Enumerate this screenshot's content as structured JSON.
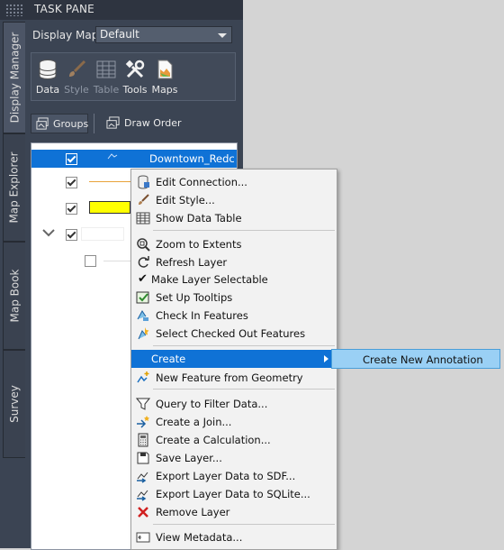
{
  "pane": {
    "title": "TASK PANE",
    "vertical_tabs": [
      "Display Manager",
      "Map Explorer",
      "Map Book",
      "Survey"
    ],
    "display_map_label": "Display Map:",
    "display_map_value": "Default",
    "toolbar": [
      {
        "label": "Data",
        "icon": "database-icon",
        "enabled": true
      },
      {
        "label": "Style",
        "icon": "brush-icon",
        "enabled": false
      },
      {
        "label": "Table",
        "icon": "table-icon",
        "enabled": false
      },
      {
        "label": "Tools",
        "icon": "tools-icon",
        "enabled": true
      },
      {
        "label": "Maps",
        "icon": "maps-icon",
        "enabled": true
      }
    ],
    "groups_label": "Groups",
    "draw_order_label": "Draw Order",
    "layer_name": "Downtown_Redc",
    "colors": {
      "selection": "#0f72d6",
      "pane_bg": "#3b4453",
      "swatch_yellow": "#ffff00",
      "swatch_line": "#e8a33a"
    }
  },
  "menu": {
    "items": [
      {
        "label": "Edit Connection...",
        "icon": "connection-icon"
      },
      {
        "label": "Edit Style...",
        "icon": "brush-icon"
      },
      {
        "label": "Show Data Table",
        "icon": "table-icon"
      },
      {
        "label": "Zoom to Extents",
        "icon": "zoom-extents-icon"
      },
      {
        "label": "Refresh Layer",
        "icon": "refresh-icon"
      },
      {
        "label": "Make Layer Selectable",
        "icon": "checkmark-icon"
      },
      {
        "label": "Set Up Tooltips",
        "icon": "tooltip-icon"
      },
      {
        "label": "Check In Features",
        "icon": "check-in-icon"
      },
      {
        "label": "Select Checked Out Features",
        "icon": "select-checked-out-icon"
      },
      {
        "label": "Create",
        "icon": ""
      },
      {
        "label": "New Feature from Geometry",
        "icon": "new-feature-icon"
      },
      {
        "label": "Query to Filter Data...",
        "icon": "filter-icon"
      },
      {
        "label": "Create a Join...",
        "icon": "join-icon"
      },
      {
        "label": "Create a Calculation...",
        "icon": "calculator-icon"
      },
      {
        "label": "Save Layer...",
        "icon": "save-icon"
      },
      {
        "label": "Export Layer Data to SDF...",
        "icon": "export-sdf-icon"
      },
      {
        "label": "Export Layer Data to SQLite...",
        "icon": "export-sqlite-icon"
      },
      {
        "label": "Remove Layer",
        "icon": "remove-icon"
      },
      {
        "label": "View Metadata...",
        "icon": "metadata-icon"
      }
    ],
    "submenu_item": "Create New Annotation"
  }
}
